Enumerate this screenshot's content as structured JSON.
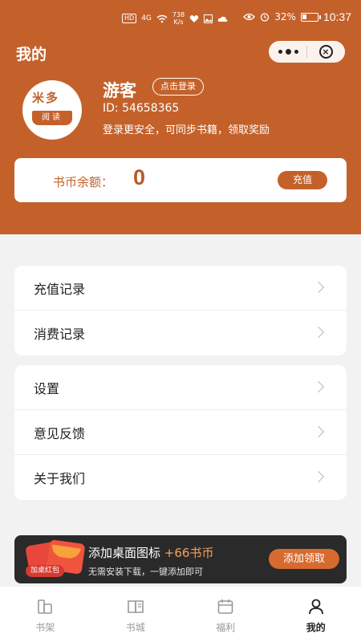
{
  "status_bar": {
    "hd": "HD",
    "network": "4G",
    "speed_value": "738",
    "speed_unit": "K/s",
    "battery": "32%",
    "battery_level": 0.32,
    "time": "10:37"
  },
  "header": {
    "title": "我的"
  },
  "profile": {
    "avatar_line1": "米多",
    "avatar_line2": "阅读",
    "username": "游客",
    "login_button": "点击登录",
    "user_id": "ID: 54658365",
    "hint": "登录更安全，可同步书籍，领取奖励"
  },
  "balance": {
    "label": "书币余额：",
    "value": "0",
    "recharge_button": "充值"
  },
  "menu_group1": [
    {
      "label": "充值记录"
    },
    {
      "label": "消费记录"
    }
  ],
  "menu_group2": [
    {
      "label": "设置"
    },
    {
      "label": "意见反馈"
    },
    {
      "label": "关于我们"
    }
  ],
  "promo": {
    "tag": "加桌红包",
    "title": "添加桌面图标",
    "highlight": "+66书币",
    "subtitle": "无需安装下载，一键添加即可",
    "button": "添加领取"
  },
  "tabs": [
    {
      "label": "书架",
      "icon": "bookshelf-icon"
    },
    {
      "label": "书城",
      "icon": "book-open-icon"
    },
    {
      "label": "福利",
      "icon": "calendar-icon"
    },
    {
      "label": "我的",
      "icon": "user-icon",
      "active": true
    }
  ],
  "colors": {
    "accent": "#c4612b",
    "page_background": "#f3f2f2",
    "promo_background": "#2b2a2a",
    "promo_highlight": "#f2a15f"
  }
}
